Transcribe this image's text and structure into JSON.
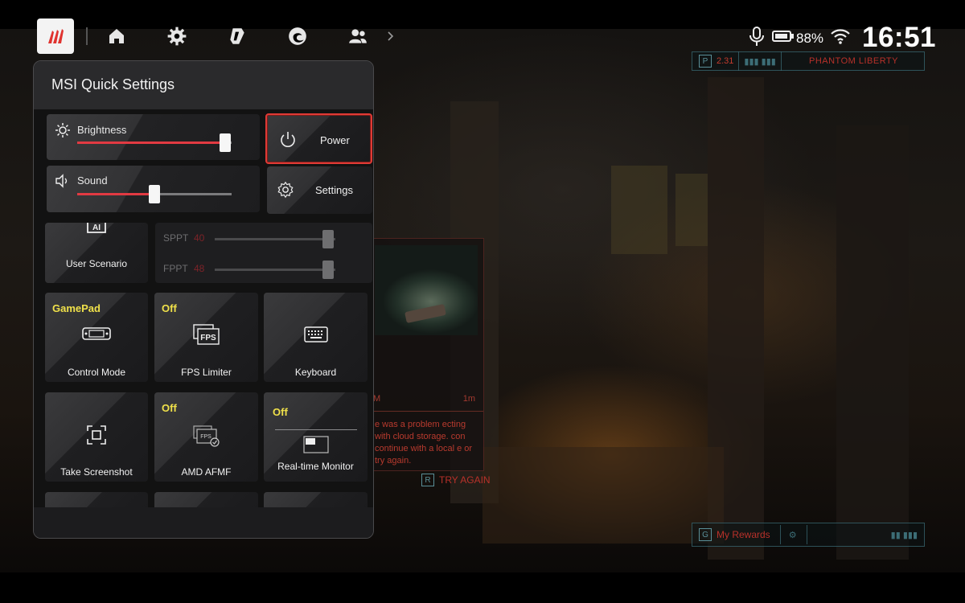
{
  "status_bar": {
    "battery_percent": "88%",
    "time": "16:51",
    "top_icons": [
      "home-icon",
      "gear-icon",
      "copilot-icon",
      "edge-icon",
      "people-icon",
      "chevron-right-icon"
    ]
  },
  "game_hud": {
    "top_key": "P",
    "top_value": "2.31",
    "top_title": "PHANTOM LIBERTY",
    "card_time_left": "M",
    "card_time_right": "1m",
    "card_message": "e was a problem ecting with cloud storage. con continue with a local e or try again.",
    "try_again_key": "R",
    "try_again_label": "TRY AGAIN",
    "rewards_key": "G",
    "rewards_label": "My Rewards"
  },
  "panel": {
    "title": "MSI Quick Settings",
    "brightness": {
      "label": "Brightness",
      "level": 0.96
    },
    "sound": {
      "label": "Sound",
      "level": 0.5
    },
    "power_label": "Power",
    "settings_label": "Settings",
    "user_scenario_label": "User Scenario",
    "tdp": [
      {
        "name": "SPPT",
        "value": "40"
      },
      {
        "name": "FPPT",
        "value": "48"
      }
    ],
    "tiles": [
      {
        "state": "GamePad",
        "label": "Control Mode",
        "icon": "gamepad-icon"
      },
      {
        "state": "Off",
        "label": "FPS Limiter",
        "icon": "fps-icon"
      },
      {
        "state": "",
        "label": "Keyboard",
        "icon": "keyboard-icon"
      },
      {
        "state": "",
        "label": "Take Screenshot",
        "icon": "screenshot-icon"
      },
      {
        "state": "Off",
        "label": "AMD AFMF",
        "icon": "afmf-icon"
      },
      {
        "state": "Off",
        "label": "Real-time Monitor",
        "icon": "monitor-icon"
      }
    ]
  },
  "colors": {
    "accent_red": "#e23a42",
    "state_yellow": "#f0e14a",
    "panel_bg": "#1c1c1e"
  }
}
